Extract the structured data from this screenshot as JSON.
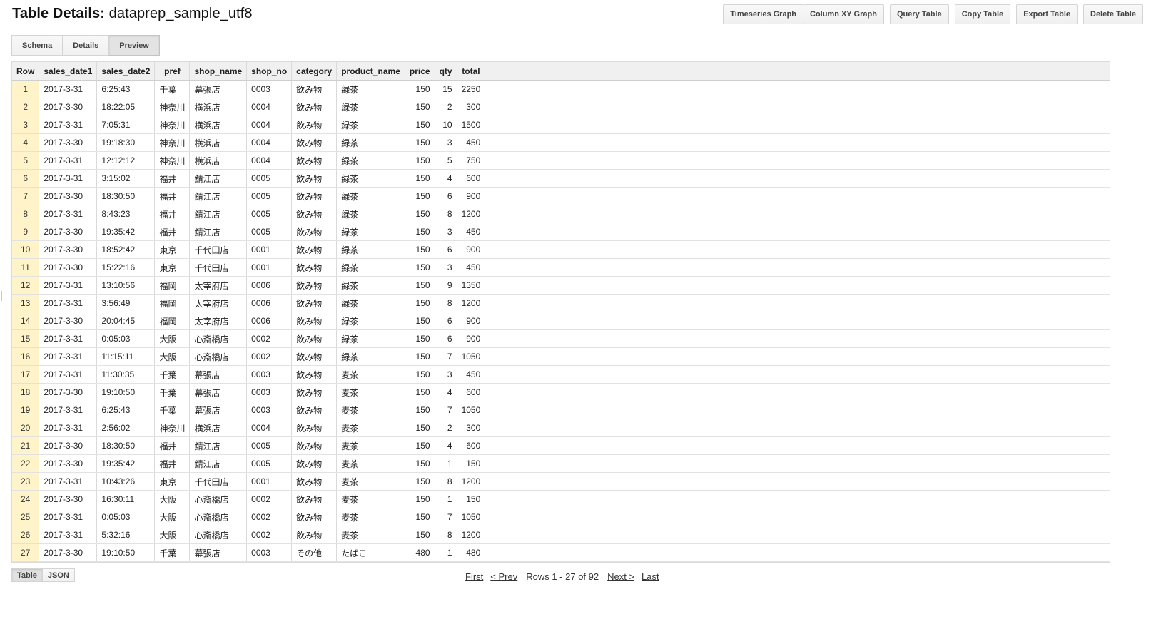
{
  "header": {
    "title_prefix": "Table Details: ",
    "table_name": "dataprep_sample_utf8"
  },
  "actions": {
    "timeseries_graph": "Timeseries Graph",
    "column_xy_graph": "Column XY Graph",
    "query_table": "Query Table",
    "copy_table": "Copy Table",
    "export_table": "Export Table",
    "delete_table": "Delete Table"
  },
  "tabs": [
    {
      "label": "Schema",
      "active": false
    },
    {
      "label": "Details",
      "active": false
    },
    {
      "label": "Preview",
      "active": true
    }
  ],
  "table": {
    "columns": [
      "Row",
      "sales_date1",
      "sales_date2",
      "pref",
      "shop_name",
      "shop_no",
      "category",
      "product_name",
      "price",
      "qty",
      "total"
    ],
    "rows": [
      [
        "1",
        "2017-3-31",
        "6:25:43",
        "千葉",
        "幕張店",
        "0003",
        "飲み物",
        "緑茶",
        "150",
        "15",
        "2250"
      ],
      [
        "2",
        "2017-3-30",
        "18:22:05",
        "神奈川",
        "横浜店",
        "0004",
        "飲み物",
        "緑茶",
        "150",
        "2",
        "300"
      ],
      [
        "3",
        "2017-3-31",
        "7:05:31",
        "神奈川",
        "横浜店",
        "0004",
        "飲み物",
        "緑茶",
        "150",
        "10",
        "1500"
      ],
      [
        "4",
        "2017-3-30",
        "19:18:30",
        "神奈川",
        "横浜店",
        "0004",
        "飲み物",
        "緑茶",
        "150",
        "3",
        "450"
      ],
      [
        "5",
        "2017-3-31",
        "12:12:12",
        "神奈川",
        "横浜店",
        "0004",
        "飲み物",
        "緑茶",
        "150",
        "5",
        "750"
      ],
      [
        "6",
        "2017-3-31",
        "3:15:02",
        "福井",
        "鯖江店",
        "0005",
        "飲み物",
        "緑茶",
        "150",
        "4",
        "600"
      ],
      [
        "7",
        "2017-3-30",
        "18:30:50",
        "福井",
        "鯖江店",
        "0005",
        "飲み物",
        "緑茶",
        "150",
        "6",
        "900"
      ],
      [
        "8",
        "2017-3-31",
        "8:43:23",
        "福井",
        "鯖江店",
        "0005",
        "飲み物",
        "緑茶",
        "150",
        "8",
        "1200"
      ],
      [
        "9",
        "2017-3-30",
        "19:35:42",
        "福井",
        "鯖江店",
        "0005",
        "飲み物",
        "緑茶",
        "150",
        "3",
        "450"
      ],
      [
        "10",
        "2017-3-30",
        "18:52:42",
        "東京",
        "千代田店",
        "0001",
        "飲み物",
        "緑茶",
        "150",
        "6",
        "900"
      ],
      [
        "11",
        "2017-3-30",
        "15:22:16",
        "東京",
        "千代田店",
        "0001",
        "飲み物",
        "緑茶",
        "150",
        "3",
        "450"
      ],
      [
        "12",
        "2017-3-31",
        "13:10:56",
        "福岡",
        "太宰府店",
        "0006",
        "飲み物",
        "緑茶",
        "150",
        "9",
        "1350"
      ],
      [
        "13",
        "2017-3-31",
        "3:56:49",
        "福岡",
        "太宰府店",
        "0006",
        "飲み物",
        "緑茶",
        "150",
        "8",
        "1200"
      ],
      [
        "14",
        "2017-3-30",
        "20:04:45",
        "福岡",
        "太宰府店",
        "0006",
        "飲み物",
        "緑茶",
        "150",
        "6",
        "900"
      ],
      [
        "15",
        "2017-3-31",
        "0:05:03",
        "大阪",
        "心斎橋店",
        "0002",
        "飲み物",
        "緑茶",
        "150",
        "6",
        "900"
      ],
      [
        "16",
        "2017-3-31",
        "11:15:11",
        "大阪",
        "心斎橋店",
        "0002",
        "飲み物",
        "緑茶",
        "150",
        "7",
        "1050"
      ],
      [
        "17",
        "2017-3-31",
        "11:30:35",
        "千葉",
        "幕張店",
        "0003",
        "飲み物",
        "麦茶",
        "150",
        "3",
        "450"
      ],
      [
        "18",
        "2017-3-30",
        "19:10:50",
        "千葉",
        "幕張店",
        "0003",
        "飲み物",
        "麦茶",
        "150",
        "4",
        "600"
      ],
      [
        "19",
        "2017-3-31",
        "6:25:43",
        "千葉",
        "幕張店",
        "0003",
        "飲み物",
        "麦茶",
        "150",
        "7",
        "1050"
      ],
      [
        "20",
        "2017-3-31",
        "2:56:02",
        "神奈川",
        "横浜店",
        "0004",
        "飲み物",
        "麦茶",
        "150",
        "2",
        "300"
      ],
      [
        "21",
        "2017-3-30",
        "18:30:50",
        "福井",
        "鯖江店",
        "0005",
        "飲み物",
        "麦茶",
        "150",
        "4",
        "600"
      ],
      [
        "22",
        "2017-3-30",
        "19:35:42",
        "福井",
        "鯖江店",
        "0005",
        "飲み物",
        "麦茶",
        "150",
        "1",
        "150"
      ],
      [
        "23",
        "2017-3-31",
        "10:43:26",
        "東京",
        "千代田店",
        "0001",
        "飲み物",
        "麦茶",
        "150",
        "8",
        "1200"
      ],
      [
        "24",
        "2017-3-30",
        "16:30:11",
        "大阪",
        "心斎橋店",
        "0002",
        "飲み物",
        "麦茶",
        "150",
        "1",
        "150"
      ],
      [
        "25",
        "2017-3-31",
        "0:05:03",
        "大阪",
        "心斎橋店",
        "0002",
        "飲み物",
        "麦茶",
        "150",
        "7",
        "1050"
      ],
      [
        "26",
        "2017-3-31",
        "5:32:16",
        "大阪",
        "心斎橋店",
        "0002",
        "飲み物",
        "麦茶",
        "150",
        "8",
        "1200"
      ],
      [
        "27",
        "2017-3-30",
        "19:10:50",
        "千葉",
        "幕張店",
        "0003",
        "その他",
        "たばこ",
        "480",
        "1",
        "480"
      ]
    ]
  },
  "view_toggle": [
    {
      "label": "Table",
      "active": true
    },
    {
      "label": "JSON",
      "active": false
    }
  ],
  "pagination": {
    "first": "First",
    "prev": "< Prev",
    "rows_info": "Rows 1 - 27 of 92",
    "next": "Next >",
    "last": "Last"
  },
  "colors": {
    "row_number_bg": "#fff3c9",
    "header_bg": "#f0f0f0",
    "border": "#dadada"
  }
}
